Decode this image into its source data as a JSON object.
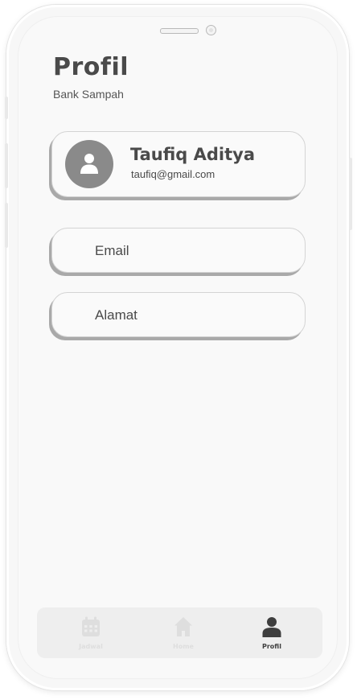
{
  "header": {
    "title": "Profil",
    "subtitle": "Bank Sampah"
  },
  "profile": {
    "name": "Taufiq Aditya",
    "email": "taufiq@gmail.com",
    "avatar_icon": "user-icon"
  },
  "fields": [
    {
      "label": "Email"
    },
    {
      "label": "Alamat"
    }
  ],
  "bottom_nav": {
    "items": [
      {
        "label": "Jadwal",
        "icon": "calendar-icon",
        "active": false
      },
      {
        "label": "Home",
        "icon": "home-icon",
        "active": false
      },
      {
        "label": "Profil",
        "icon": "user-icon",
        "active": true
      }
    ]
  },
  "colors": {
    "text_primary": "#4a4a4a",
    "avatar_bg": "#8a8a8a",
    "nav_active": "#3e3e3e",
    "nav_inactive": "#dedede",
    "card_shadow": "#a9a9a9"
  }
}
